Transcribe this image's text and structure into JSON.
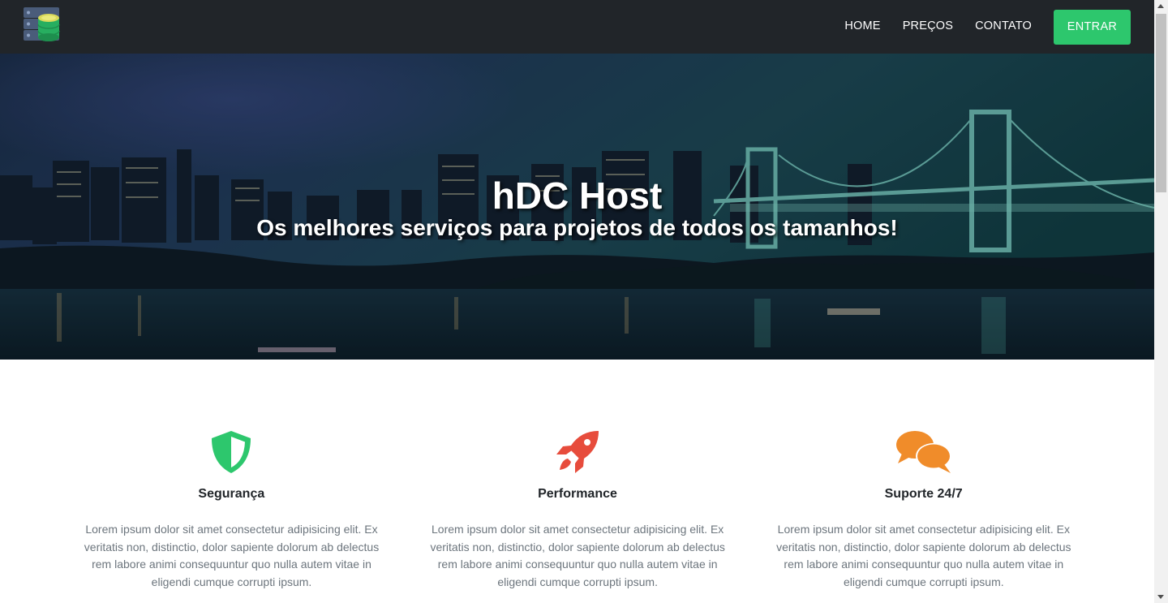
{
  "navbar": {
    "logo_icon": "server-database-icon",
    "links": [
      {
        "label": "HOME"
      },
      {
        "label": "PREÇOS"
      },
      {
        "label": "CONTATO"
      }
    ],
    "login_label": "ENTRAR",
    "colors": {
      "background": "#212529",
      "accent": "#2dc76d"
    }
  },
  "hero": {
    "title": "hDC Host",
    "subtitle": "Os melhores serviços para projetos de todos os tamanhos!",
    "background": "night-city-skyline-bridge-image"
  },
  "features": [
    {
      "icon": "shield-icon",
      "color": "#2dc76d",
      "title": "Segurança",
      "text": "Lorem ipsum dolor sit amet consectetur adipisicing elit. Ex veritatis non, distinctio, dolor sapiente dolorum ab delectus rem labore animi consequuntur quo nulla autem vitae in eligendi cumque corrupti ipsum."
    },
    {
      "icon": "rocket-icon",
      "color": "#e74c3c",
      "title": "Performance",
      "text": "Lorem ipsum dolor sit amet consectetur adipisicing elit. Ex veritatis non, distinctio, dolor sapiente dolorum ab delectus rem labore animi consequuntur quo nulla autem vitae in eligendi cumque corrupti ipsum."
    },
    {
      "icon": "comments-icon",
      "color": "#f08c2a",
      "title": "Suporte 24/7",
      "text": "Lorem ipsum dolor sit amet consectetur adipisicing elit. Ex veritatis non, distinctio, dolor sapiente dolorum ab delectus rem labore animi consequuntur quo nulla autem vitae in eligendi cumque corrupti ipsum."
    }
  ]
}
